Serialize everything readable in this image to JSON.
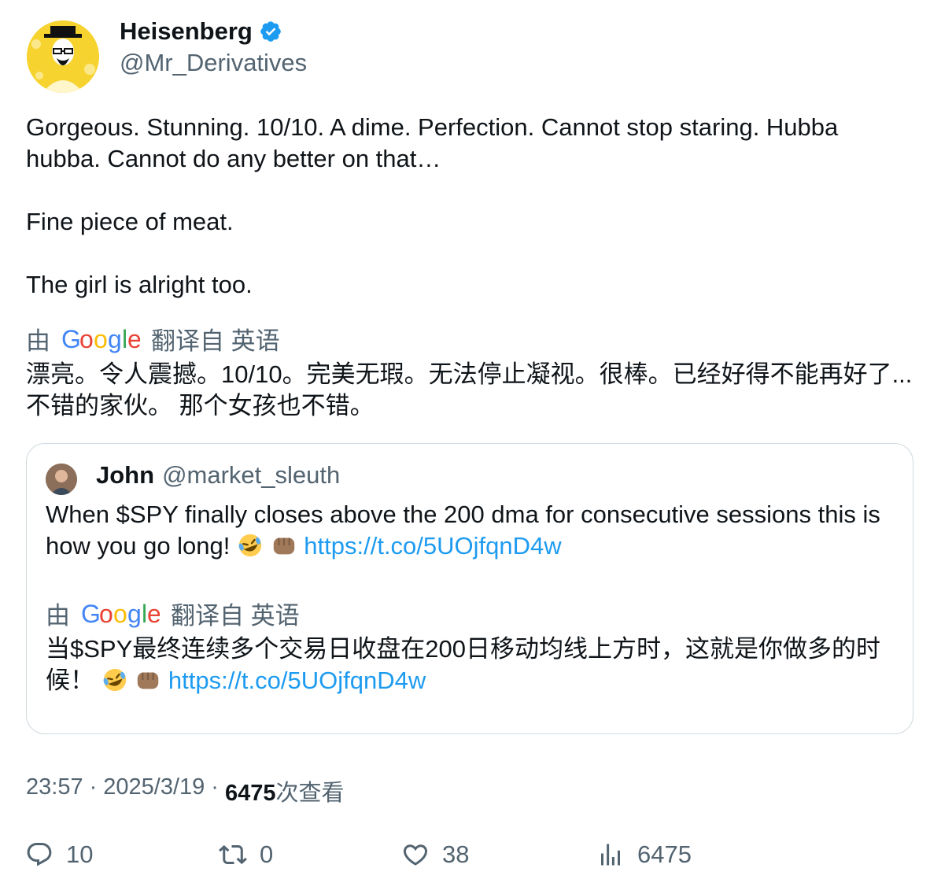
{
  "author": {
    "display_name": "Heisenberg",
    "handle": "@Mr_Derivatives",
    "avatar_icon": "bald-man-with-hat-avatar",
    "verified_icon": "verified-badge-icon"
  },
  "tweet": {
    "paragraphs": [
      "Gorgeous. Stunning. 10/10. A dime. Perfection. Cannot stop staring. Hubba hubba. Cannot do any better on that…",
      "Fine piece of meat.",
      "The girl is alright too."
    ],
    "translation_prefix": "由",
    "translation_suffix": "翻译自 英语",
    "translation_text": "漂亮。令人震撼。10/10。完美无瑕。无法停止凝视。很棒。已经好得不能再好了... 不错的家伙。 那个女孩也不错。"
  },
  "quote": {
    "display_name": "John",
    "handle": "@market_sleuth",
    "text": "When $SPY finally closes above the 200 dma for consecutive sessions this is how you go long!",
    "link": "https://t.co/5UOjfqnD4w",
    "translation_prefix": "由",
    "translation_suffix": "翻译自 英语",
    "translation_text": "当$SPY最终连续多个交易日收盘在200日移动均线上方时，这就是你做多的时候！",
    "translation_link": "https://t.co/5UOjfqnD4w"
  },
  "meta": {
    "time": "23:57",
    "sep1": "·",
    "date": "2025/3/19",
    "sep2": "·",
    "views": "6475",
    "views_label": "次查看"
  },
  "actions": {
    "replies": "10",
    "retweets": "0",
    "likes": "38",
    "views": "6475"
  },
  "colors": {
    "link": "#1d9bf0",
    "secondary_text": "#536471",
    "primary_text": "#0f1419",
    "border": "#cfd9de",
    "verified": "#1d9bf0"
  }
}
